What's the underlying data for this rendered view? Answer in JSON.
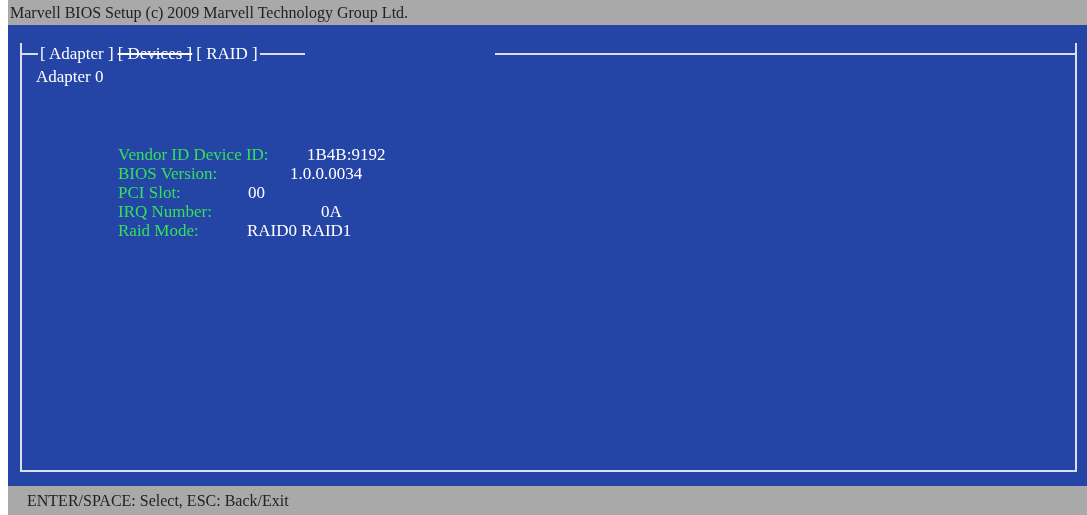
{
  "title_bar": {
    "title": "Marvell BIOS Setup (c) 2009 Marvell Technology Group Ltd."
  },
  "tabs": [
    {
      "label": "[  Adapter  ]",
      "disabled": false
    },
    {
      "label": "[ Devices  ]",
      "disabled": true
    },
    {
      "label": "[   RAID  ]",
      "disabled": false
    }
  ],
  "panel": {
    "heading": "Adapter 0",
    "fields": [
      {
        "label": "Vendor ID Device ID:",
        "value": "1B4B:9192"
      },
      {
        "label": "BIOS Version:",
        "value": "1.0.0.0034"
      },
      {
        "label": "PCI Slot:",
        "value": "00"
      },
      {
        "label": "IRQ Number:",
        "value": "0A"
      },
      {
        "label": "Raid Mode:",
        "value": "RAID0 RAID1"
      }
    ]
  },
  "status_bar": {
    "text": "ENTER/SPACE: Select, ESC: Back/Exit"
  }
}
